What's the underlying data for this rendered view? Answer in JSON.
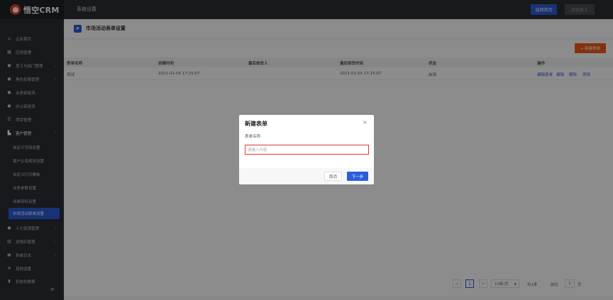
{
  "app": {
    "logo_text": "悟空CRM",
    "section_title": "系统设置"
  },
  "header": {
    "home_button": "返回首页",
    "add_employee_button": "添加员工"
  },
  "sidebar": {
    "items": [
      {
        "label": "企业首页",
        "icon": "home-icon"
      },
      {
        "label": "应用管理",
        "icon": "grid-icon"
      },
      {
        "label": "员工与部门管理",
        "icon": "users-icon",
        "has_chevron": true
      },
      {
        "label": "角色权限管理",
        "icon": "user-icon",
        "has_chevron": true
      },
      {
        "label": "业务审批流",
        "icon": "user-icon"
      },
      {
        "label": "办公审批流",
        "icon": "user-icon"
      },
      {
        "label": "项目管理",
        "icon": "list-icon"
      },
      {
        "label": "客户管理",
        "icon": "building-icon",
        "has_chevron": true
      }
    ],
    "sub_items": [
      {
        "label": "自定义字段设置"
      },
      {
        "label": "客户公海规则设置"
      },
      {
        "label": "自定义打印模板"
      },
      {
        "label": "业务参数设置"
      },
      {
        "label": "业绩目标设置"
      },
      {
        "label": "市场活动表单设置",
        "active": true
      }
    ],
    "items_after": [
      {
        "label": "人力资源管理",
        "icon": "user-icon",
        "has_chevron": true
      },
      {
        "label": "进销存管理",
        "icon": "chart-icon",
        "has_chevron": true
      },
      {
        "label": "系统日志",
        "icon": "log-icon",
        "has_chevron": true
      },
      {
        "label": "其他设置",
        "icon": "gear-icon"
      },
      {
        "label": "初始化数据",
        "icon": "data-icon"
      }
    ]
  },
  "page": {
    "title": "市场活动表单设置",
    "new_form_button": "+ 新建表单"
  },
  "table": {
    "headers": [
      "表单名称",
      "创建时间",
      "最后修改人",
      "最后修改时间",
      "状态",
      "操作"
    ],
    "rows": [
      {
        "name": "测试",
        "created": "2021-01-05 17:15:07",
        "modifier": "",
        "modified": "2021-01-05 17:15:07",
        "status": "启用"
      }
    ],
    "actions": [
      "编辑表单",
      "编辑",
      "删除",
      "停用"
    ]
  },
  "pagination": {
    "prev": "<",
    "current": "1",
    "next": ">",
    "page_size": "10条/页",
    "total": "共1条",
    "goto_label": "前往",
    "goto_value": "1",
    "page_suffix": "页"
  },
  "modal": {
    "title": "新建表单",
    "close": "×",
    "field_label": "表单名称",
    "placeholder": "请输入内容",
    "cancel": "取消",
    "next": "下一步"
  }
}
